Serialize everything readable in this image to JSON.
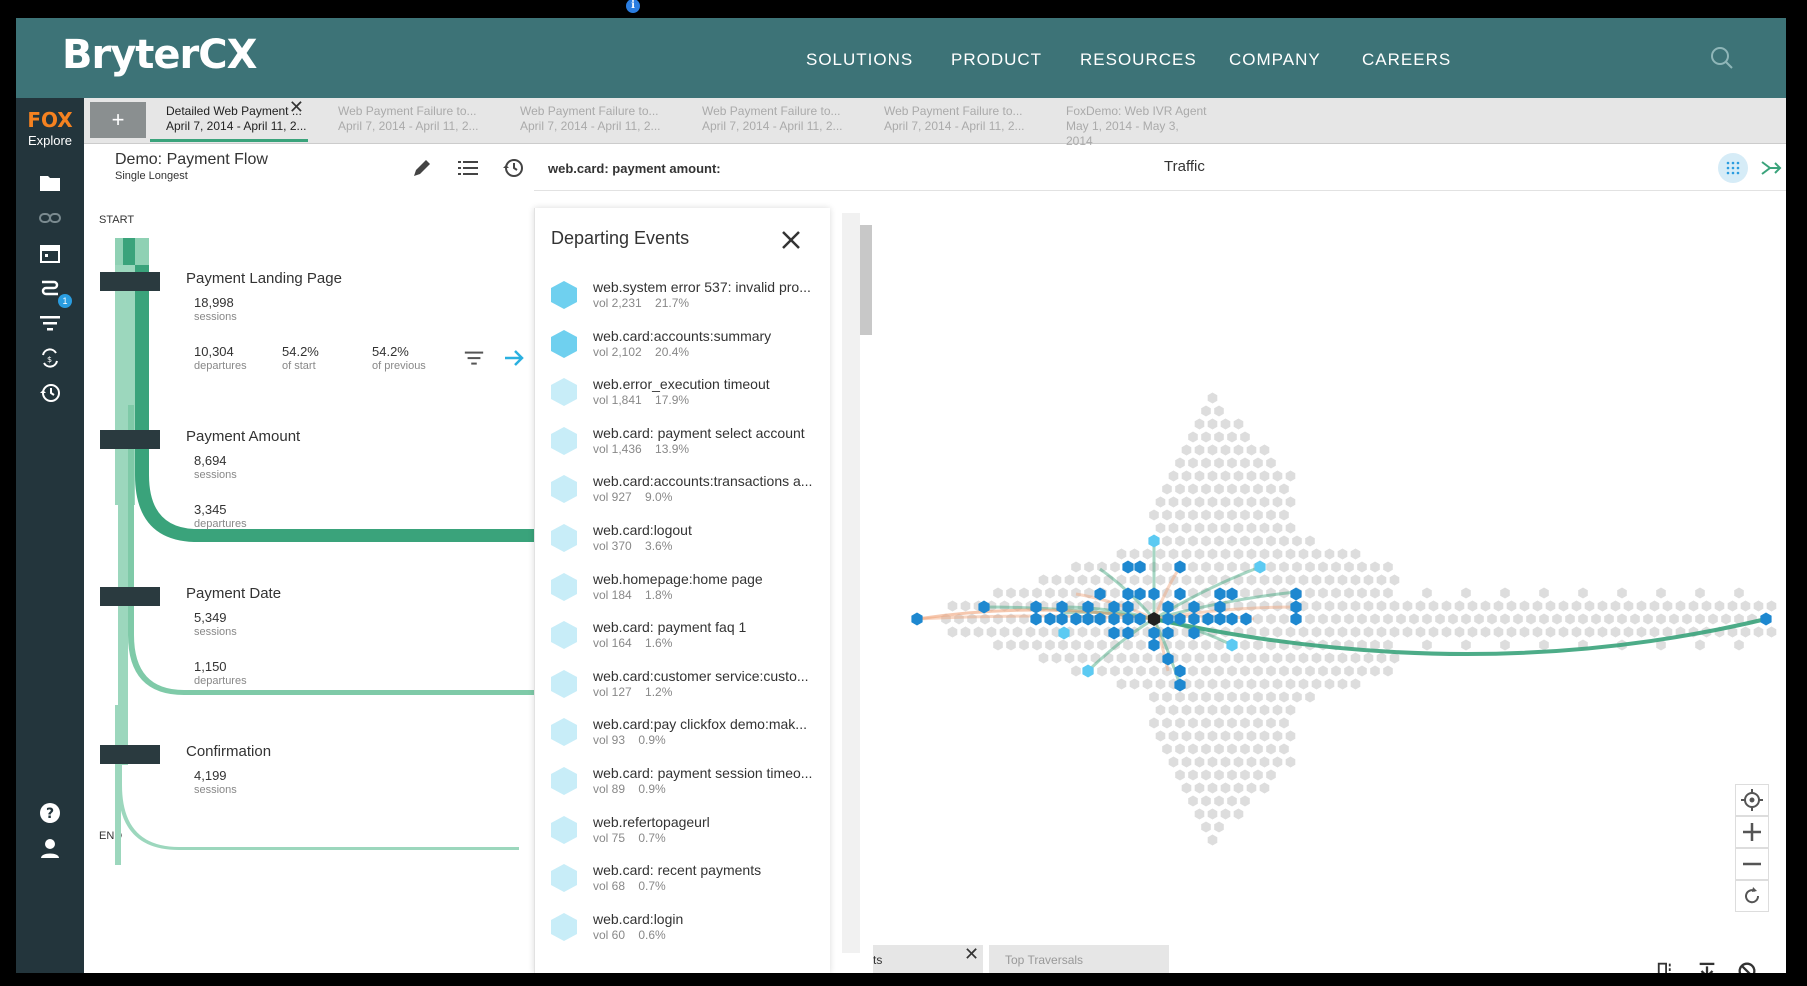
{
  "header": {
    "logo": "BryterCX",
    "nav": [
      "SOLUTIONS",
      "PRODUCT",
      "RESOURCES",
      "COMPANY",
      "CAREERS"
    ]
  },
  "rail": {
    "logo": "FOX",
    "label": "Explore",
    "badge": "1",
    "icons": [
      "folder-icon",
      "link-icon",
      "calendar-icon",
      "paths-icon",
      "filter-icon",
      "swap-icon",
      "history-icon",
      "help-icon",
      "user-icon"
    ]
  },
  "tabs": {
    "add_label": "+",
    "items": [
      {
        "title": "Detailed Web Payment ...",
        "range": "April 7, 2014 - April 11, 2...",
        "active": true
      },
      {
        "title": "Web Payment Failure to...",
        "range": "April 7, 2014 - April 11, 2..."
      },
      {
        "title": "Web Payment Failure to...",
        "range": "April 7, 2014 - April 11, 2..."
      },
      {
        "title": "Web Payment Failure to...",
        "range": "April 7, 2014 - April 11, 2..."
      },
      {
        "title": "Web Payment Failure to...",
        "range": "April 7, 2014 - April 11, 2..."
      },
      {
        "title": "FoxDemo: Web IVR Agent",
        "range": "May 1, 2014 - May 3, 2014"
      }
    ]
  },
  "flow": {
    "title": "Demo: Payment Flow",
    "subtitle": "Single Longest",
    "start": "START",
    "end": "END",
    "steps": [
      {
        "title": "Payment Landing Page",
        "sessions": "18,998",
        "sessions_label": "sessions",
        "departures": "10,304",
        "departures_label": "departures",
        "of_start": "54.2%",
        "of_start_label": "of start",
        "of_previous": "54.2%",
        "of_previous_label": "of previous"
      },
      {
        "title": "Payment Amount",
        "sessions": "8,694",
        "sessions_label": "sessions",
        "departures": "3,345",
        "departures_label": "departures"
      },
      {
        "title": "Payment Date",
        "sessions": "5,349",
        "sessions_label": "sessions",
        "departures": "1,150",
        "departures_label": "departures"
      },
      {
        "title": "Confirmation",
        "sessions": "4,199",
        "sessions_label": "sessions"
      }
    ]
  },
  "events": {
    "title": "Departing Events",
    "items": [
      {
        "name": "web.system error 537: invalid pro...",
        "vol": "vol 2,231    21.7%",
        "shade": "#6fd0ef"
      },
      {
        "name": "web.card:accounts:summary",
        "vol": "vol 2,102    20.4%",
        "shade": "#6fd0ef"
      },
      {
        "name": "web.error_execution timeout",
        "vol": "vol 1,841    17.9%",
        "shade": "#c8edf8"
      },
      {
        "name": "web.card: payment select account",
        "vol": "vol 1,436    13.9%",
        "shade": "#c8edf8"
      },
      {
        "name": "web.card:accounts:transactions a...",
        "vol": "vol 927    9.0%",
        "shade": "#c8edf8"
      },
      {
        "name": "web.card:logout",
        "vol": "vol 370    3.6%",
        "shade": "#c8edf8"
      },
      {
        "name": "web.homepage:home page",
        "vol": "vol 184    1.8%",
        "shade": "#c8edf8"
      },
      {
        "name": "web.card: payment faq 1",
        "vol": "vol 164    1.6%",
        "shade": "#c8edf8"
      },
      {
        "name": "web.card:customer service:custo...",
        "vol": "vol 127    1.2%",
        "shade": "#c8edf8"
      },
      {
        "name": "web.card:pay clickfox demo:mak...",
        "vol": "vol 93    0.9%",
        "shade": "#c8edf8"
      },
      {
        "name": "web.card: payment session timeo...",
        "vol": "vol 89    0.9%",
        "shade": "#c8edf8"
      },
      {
        "name": "web.refertopageurl",
        "vol": "vol 75    0.7%",
        "shade": "#c8edf8"
      },
      {
        "name": "web.card: recent payments",
        "vol": "vol 68    0.7%",
        "shade": "#c8edf8"
      },
      {
        "name": "web.card:login",
        "vol": "vol 60    0.6%",
        "shade": "#c8edf8"
      }
    ]
  },
  "viz": {
    "label": "web.card: payment amount:",
    "value": "Traffic",
    "info": "i",
    "colors": {
      "node_gray": "#dddddd",
      "node_blue": "#1e88d0",
      "node_light": "#5ccaf2",
      "center": "#222222",
      "green_line": "#3aa37b",
      "orange_line": "#f0a37a"
    }
  },
  "bottom": {
    "tab1": "ts",
    "tab2": "Top Traversals"
  }
}
